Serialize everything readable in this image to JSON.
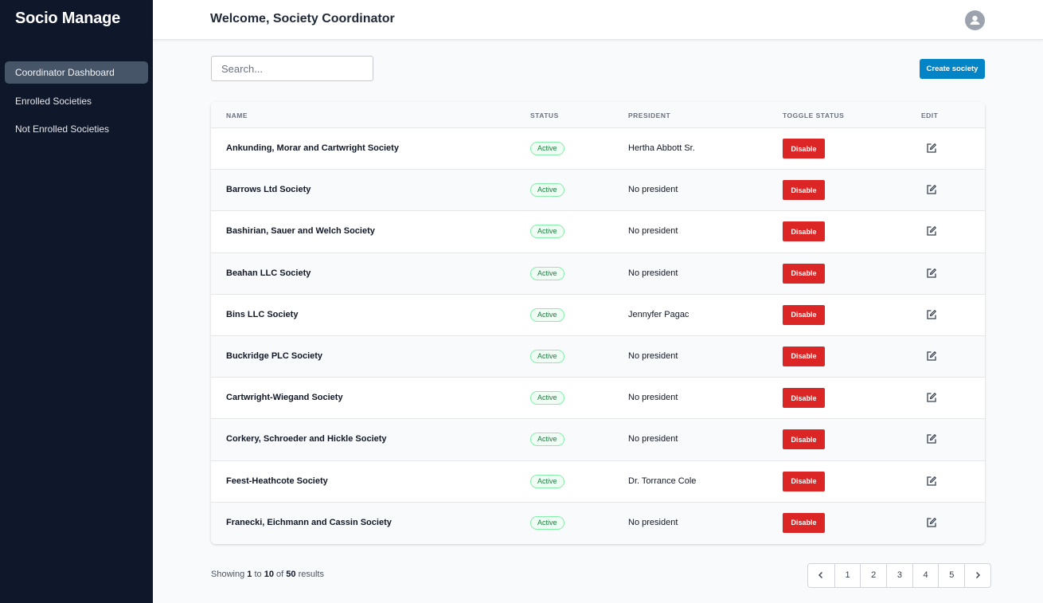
{
  "sidebar": {
    "brand": "Socio Manage",
    "items": [
      {
        "label": "Coordinator Dashboard",
        "active": true
      },
      {
        "label": "Enrolled Societies",
        "active": false
      },
      {
        "label": "Not Enrolled Societies",
        "active": false
      }
    ]
  },
  "header": {
    "welcome": "Welcome, Society Coordinator",
    "avatar_icon": "user-icon"
  },
  "toolbar": {
    "search_placeholder": "Search...",
    "search_value": "",
    "create_label": "Create society"
  },
  "table": {
    "columns": [
      "NAME",
      "STATUS",
      "PRESIDENT",
      "TOGGLE STATUS",
      "EDIT"
    ],
    "rows": [
      {
        "name": "Ankunding, Morar and Cartwright Society",
        "status": "Active",
        "president": "Hertha Abbott Sr.",
        "toggle": "Disable"
      },
      {
        "name": "Barrows Ltd Society",
        "status": "Active",
        "president": "No president",
        "toggle": "Disable"
      },
      {
        "name": "Bashirian, Sauer and Welch Society",
        "status": "Active",
        "president": "No president",
        "toggle": "Disable"
      },
      {
        "name": "Beahan LLC Society",
        "status": "Active",
        "president": "No president",
        "toggle": "Disable"
      },
      {
        "name": "Bins LLC Society",
        "status": "Active",
        "president": "Jennyfer Pagac",
        "toggle": "Disable"
      },
      {
        "name": "Buckridge PLC Society",
        "status": "Active",
        "president": "No president",
        "toggle": "Disable"
      },
      {
        "name": "Cartwright-Wiegand Society",
        "status": "Active",
        "president": "No president",
        "toggle": "Disable"
      },
      {
        "name": "Corkery, Schroeder and Hickle Society",
        "status": "Active",
        "president": "No president",
        "toggle": "Disable"
      },
      {
        "name": "Feest-Heathcote Society",
        "status": "Active",
        "president": "Dr. Torrance Cole",
        "toggle": "Disable"
      },
      {
        "name": "Franecki, Eichmann and Cassin Society",
        "status": "Active",
        "president": "No president",
        "toggle": "Disable"
      }
    ]
  },
  "pagination": {
    "showing_prefix": "Showing",
    "from": "1",
    "to_word": "to",
    "to": "10",
    "of_word": "of",
    "total": "50",
    "results_word": "results",
    "pages": [
      "1",
      "2",
      "3",
      "4",
      "5"
    ]
  },
  "colors": {
    "sidebar_bg": "#0f172a",
    "primary": "#0284c7",
    "danger": "#dc2626",
    "active_badge": "#15803d"
  }
}
